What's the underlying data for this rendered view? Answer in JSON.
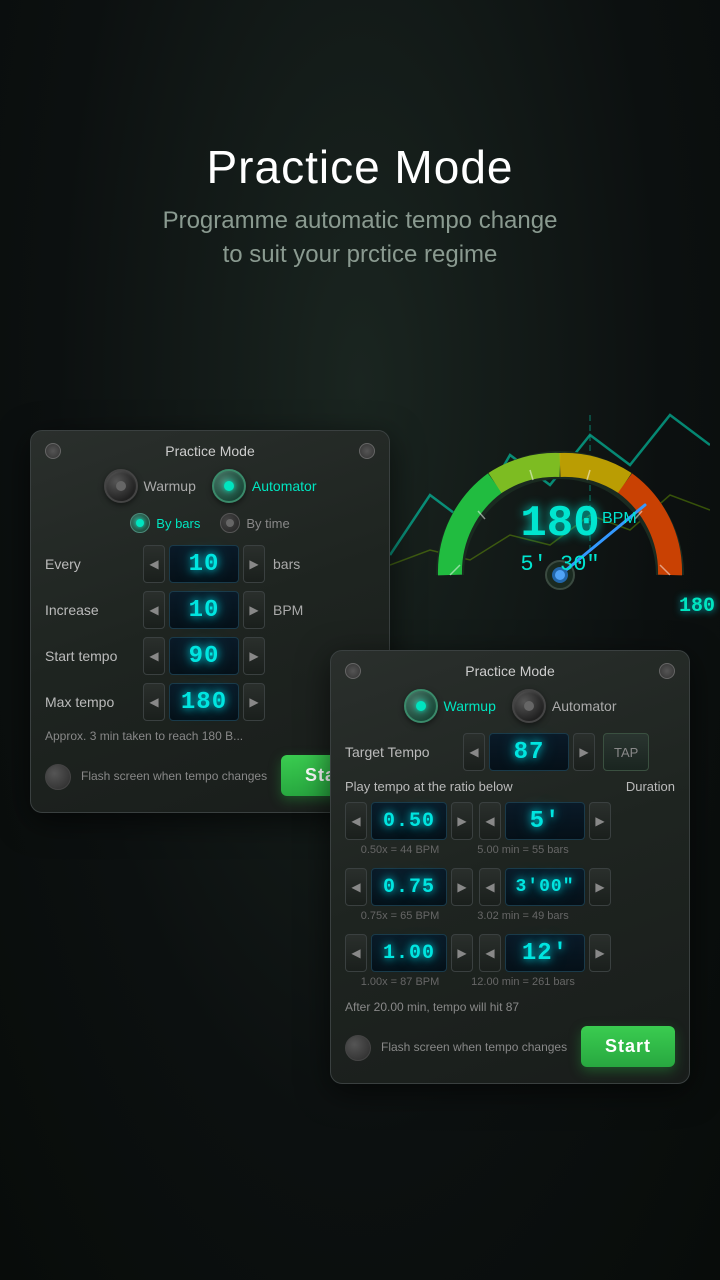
{
  "header": {
    "title": "Practice Mode",
    "subtitle_line1": "Programme automatic tempo change",
    "subtitle_line2": "to suit your prctice regime"
  },
  "panel_left": {
    "title": "Practice Mode",
    "tab_warmup": "Warmup",
    "tab_automator": "Automator",
    "seg_by_bars": "By bars",
    "seg_by_time": "By time",
    "row_every": {
      "label": "Every",
      "value": "10",
      "unit": "bars"
    },
    "row_increase": {
      "label": "Increase",
      "value": "10",
      "unit": "BPM"
    },
    "row_start_tempo": {
      "label": "Start tempo",
      "value": "90"
    },
    "row_max_tempo": {
      "label": "Max tempo",
      "value": "180"
    },
    "info": "Approx. 3 min taken to reach 180 B...",
    "flash_label": "Flash screen when\ntempo changes",
    "start_btn": "Start"
  },
  "panel_right": {
    "title": "Practice Mode",
    "tab_warmup": "Warmup",
    "tab_automator": "Automator",
    "target_tempo_label": "Target Tempo",
    "target_tempo_value": "87",
    "tap_label": "TAP",
    "ratio_header": "Play tempo at the ratio below",
    "duration_header": "Duration",
    "rows": [
      {
        "ratio": "0.50",
        "ratio_sub": "0.50x = 44 BPM",
        "duration": "5'",
        "duration_sub": "5.00 min = 55 bars"
      },
      {
        "ratio": "0.75",
        "ratio_sub": "0.75x = 65 BPM",
        "duration": "3'00\"",
        "duration_sub": "3.02 min = 49 bars"
      },
      {
        "ratio": "1.00",
        "ratio_sub": "1.00x = 87 BPM",
        "duration": "12'",
        "duration_sub": "12.00 min = 261 bars"
      }
    ],
    "after_text": "After 20.00 min, tempo will hit 87",
    "flash_label": "Flash screen when\ntempo changes",
    "start_btn": "Start"
  },
  "speedometer": {
    "bpm_value": "180",
    "bpm_unit": "BPM",
    "time_value": "5' 30\""
  },
  "badge": "180"
}
